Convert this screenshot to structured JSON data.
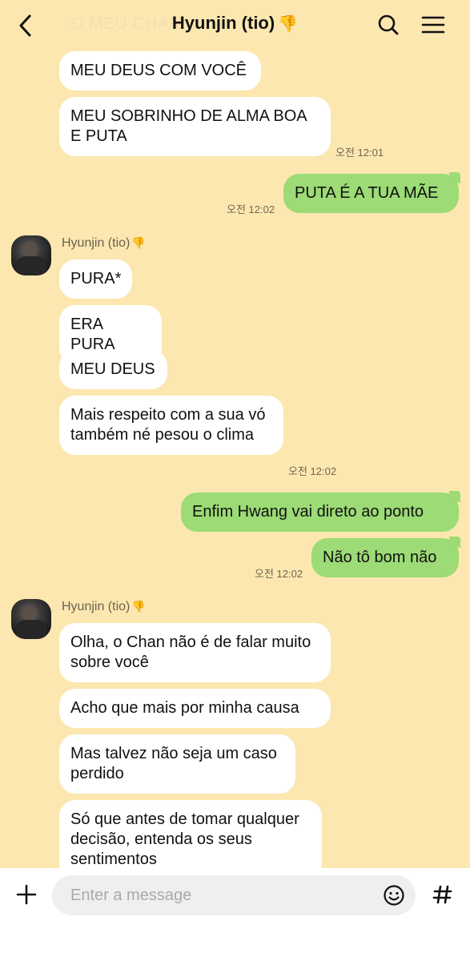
{
  "header": {
    "faded_title": "O MEU CHAN",
    "title": "Hyunjin (tio)",
    "title_emoji": "👎"
  },
  "messages": [
    {
      "text": "MEU DEUS COM VOCÊ"
    },
    {
      "text": "MEU SOBRINHO DE ALMA BOA E PUTA",
      "time": "오전 12:01"
    },
    {
      "text": "PUTA É A TUA MÃE",
      "time": "오전 12:02"
    },
    {
      "sender": "Hyunjin (tio)",
      "sender_emoji": "👎"
    },
    {
      "text": "PURA*"
    },
    {
      "text": "ERA PURA"
    },
    {
      "text": "MEU DEUS"
    },
    {
      "text": "Mais respeito com a sua vó também né pesou o clima",
      "time": "오전 12:02"
    },
    {
      "text": "Enfim Hwang vai direto ao ponto"
    },
    {
      "text": "Não tô bom não",
      "time": "오전 12:02"
    },
    {
      "sender": "Hyunjin (tio)",
      "sender_emoji": "👎"
    },
    {
      "text": "Olha, o Chan não é de falar muito sobre você"
    },
    {
      "text": "Acho que mais por minha causa"
    },
    {
      "text": "Mas talvez não seja um caso perdido"
    },
    {
      "text": "Só que antes de tomar qualquer decisão, entenda os seus sentimentos"
    }
  ],
  "composer": {
    "placeholder": "Enter a message",
    "icons": [
      "plus-icon",
      "emoji-icon",
      "hashtag-icon"
    ]
  },
  "colors": {
    "background": "#FCE7B0",
    "outgoing_bubble": "#9CDB75",
    "incoming_bubble": "#FFFFFF"
  }
}
